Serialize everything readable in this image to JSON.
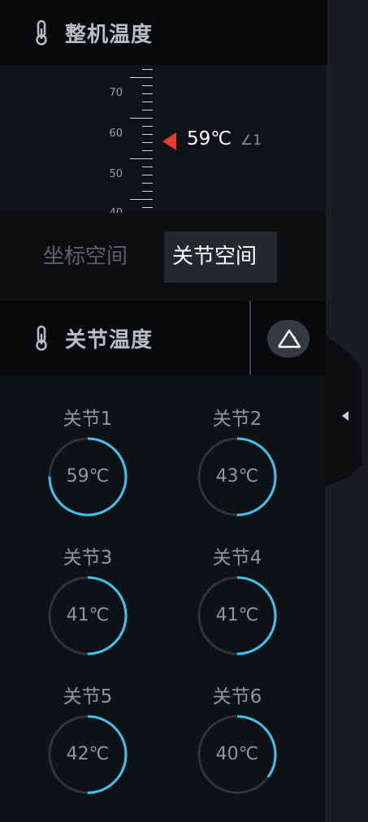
{
  "machine": {
    "title": "整机温度",
    "thermometer_icon": "thermometer-icon",
    "scale_labels": [
      "70",
      "60",
      "50",
      "40"
    ],
    "current_temp": "59℃",
    "marker_color": "#e83a30",
    "angle_indicator": "∠1"
  },
  "tabs": {
    "coordinate_space": "坐标空间",
    "joint_space": "关节空间",
    "active": "关节空间"
  },
  "joints_section": {
    "title": "关节温度",
    "thermometer_icon": "thermometer-icon",
    "angle_button_icon": "angle-icon"
  },
  "joints": [
    {
      "label": "关节1",
      "value": "59℃",
      "fraction": 0.75
    },
    {
      "label": "关节2",
      "value": "43℃",
      "fraction": 0.5
    },
    {
      "label": "关节3",
      "value": "41℃",
      "fraction": 0.5
    },
    {
      "label": "关节4",
      "value": "41℃",
      "fraction": 0.5
    },
    {
      "label": "关节5",
      "value": "42℃",
      "fraction": 0.5
    },
    {
      "label": "关节6",
      "value": "40℃",
      "fraction": 0.35
    }
  ],
  "colors": {
    "ring_progress": "#3ec3f0",
    "ring_track": "#2e3338",
    "accent_marker": "#e83a30"
  }
}
